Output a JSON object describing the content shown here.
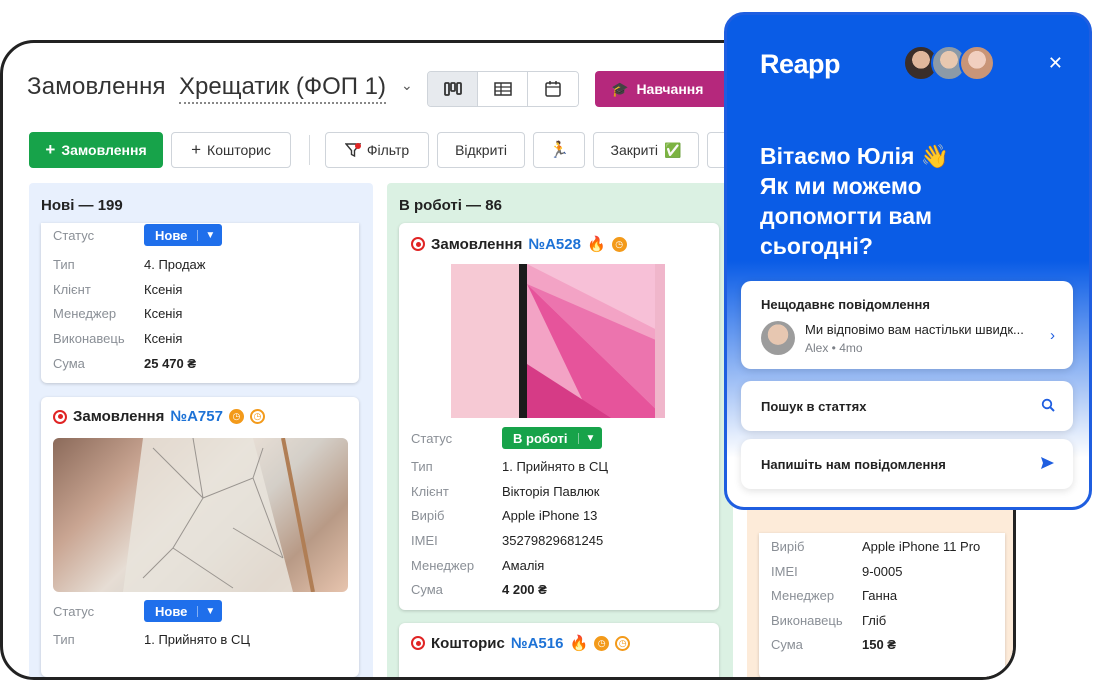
{
  "header": {
    "title": "Замовлення",
    "store": "Хрещатик (ФОП 1)",
    "learn_label": "Навчання"
  },
  "toolbar": {
    "new_order": "Замовлення",
    "estimate": "Кошторис",
    "filter": "Фільтр",
    "open": "Відкриті",
    "closed": "Закриті",
    "closed_emoji": "✅"
  },
  "columns": [
    {
      "title": "Нові — 199",
      "color": "#e8f0fd",
      "cards": [
        {
          "status": "Нове",
          "rows": [
            {
              "k": "Статус",
              "v": ""
            },
            {
              "k": "Тип",
              "v": "4. Продаж"
            },
            {
              "k": "Клієнт",
              "v": "Ксенія"
            },
            {
              "k": "Менеджер",
              "v": "Ксенія"
            },
            {
              "k": "Виконавець",
              "v": "Ксенія"
            },
            {
              "k": "Сума",
              "v": "25 470 ₴"
            }
          ]
        },
        {
          "title": "Замовлення",
          "number": "№A757",
          "status": "Нове",
          "rows": [
            {
              "k": "Статус",
              "v": ""
            },
            {
              "k": "Тип",
              "v": "1. Прийнято в СЦ"
            }
          ]
        }
      ]
    },
    {
      "title": "В роботі — 86",
      "color": "#dbf1e3",
      "cards": [
        {
          "title": "Замовлення",
          "number": "№A528",
          "status": "В роботі",
          "rows": [
            {
              "k": "Статус",
              "v": ""
            },
            {
              "k": "Тип",
              "v": "1. Прийнято в СЦ"
            },
            {
              "k": "Клієнт",
              "v": "Вікторія Павлюк"
            },
            {
              "k": "Виріб",
              "v": "Apple iPhone 13"
            },
            {
              "k": "IMEI",
              "v": "35279829681245"
            },
            {
              "k": "Менеджер",
              "v": "Амалія"
            },
            {
              "k": "Сума",
              "v": "4 200 ₴"
            }
          ]
        },
        {
          "title": "Кошторис",
          "number": "№A516"
        }
      ]
    },
    {
      "color": "#fdebd9",
      "cards": [
        {
          "rows": [
            {
              "k": "Виріб",
              "v": "Apple iPhone 11 Pro"
            },
            {
              "k": "IMEI",
              "v": "9-0005"
            },
            {
              "k": "Менеджер",
              "v": "Ганна"
            },
            {
              "k": "Виконавець",
              "v": "Гліб"
            },
            {
              "k": "Сума",
              "v": "150 ₴"
            }
          ]
        }
      ]
    }
  ],
  "chat": {
    "brand": "Reapp",
    "greeting_line1": "Вітаємо Юлія 👋",
    "greeting_line2": "Як ми можемо",
    "greeting_line3": "допомогти вам",
    "greeting_line4": "сьогодні?",
    "recent_title": "Нещодавнє повідомлення",
    "recent_text": "Ми відповімо вам настільки швидк...",
    "recent_author": "Alex",
    "recent_time": "4mo",
    "search_label": "Пошук в статтях",
    "write_label": "Напишіть нам повідомлення"
  },
  "colors": {
    "green": "#17a34a",
    "blue_status": "#1f6feb",
    "purple": "#b5287c",
    "chat_blue": "#0a5ce6"
  }
}
